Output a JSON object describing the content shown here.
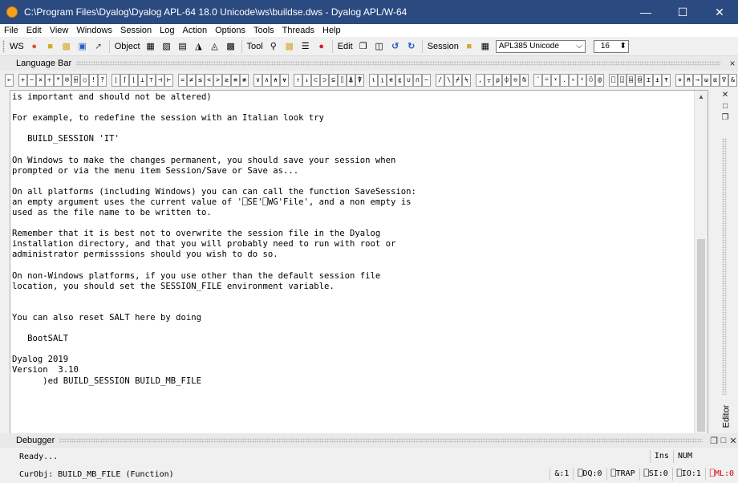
{
  "window": {
    "title": "C:\\Program Files\\Dyalog\\Dyalog APL-64 18.0 Unicode\\ws\\buildse.dws - Dyalog APL/W-64",
    "minimize": "—",
    "maximize": "☐",
    "close": "✕"
  },
  "menu": [
    "File",
    "Edit",
    "View",
    "Windows",
    "Session",
    "Log",
    "Action",
    "Options",
    "Tools",
    "Threads",
    "Help"
  ],
  "toolbar": {
    "ws_label": "WS",
    "object_label": "Object",
    "tool_label": "Tool",
    "edit_label": "Edit",
    "session_label": "Session",
    "font_value": "APL385 Unicode",
    "font_arrow": "⌵",
    "size_value": "16",
    "size_spinner": "⬍"
  },
  "language_bar": {
    "title": "Language Bar",
    "close": "×",
    "groups": [
      [
        "←"
      ],
      [
        "+",
        "−",
        "×",
        "÷",
        "*",
        "⍟",
        "⌹",
        "○",
        "!",
        "?"
      ],
      [
        "|",
        "⌈",
        "⌊",
        "⊥",
        "⊤",
        "⊣",
        "⊢"
      ],
      [
        "=",
        "≠",
        "≤",
        "<",
        ">",
        "≥",
        "≡",
        "≢"
      ],
      [
        "∨",
        "∧",
        "⍲",
        "⍱"
      ],
      [
        "↑",
        "↓",
        "⊂",
        "⊃",
        "⊆",
        "⌷",
        "⍋",
        "⍒"
      ],
      [
        "⍳",
        "⍸",
        "∊",
        "⍷",
        "∪",
        "∩",
        "~"
      ],
      [
        "/",
        "\\",
        "⌿",
        "⍀"
      ],
      [
        ",",
        "⍪",
        "⍴",
        "⌽",
        "⊖",
        "⍉"
      ],
      [
        "¨",
        "⍨",
        "⍣",
        ".",
        "∘",
        "⍤",
        "⍥",
        "@"
      ],
      [
        "⎕",
        "⍠",
        "⌸",
        "⌺",
        "⌶",
        "⍎",
        "⍕"
      ],
      [
        "⋄",
        "⍝",
        "→",
        "⍵",
        "⍺",
        "∇",
        "&"
      ],
      [
        "¯",
        "⍬"
      ]
    ]
  },
  "editor": {
    "lines": [
      "is important and should not be altered)",
      "",
      "For example, to redefine the session with an Italian look try",
      "",
      "   BUILD_SESSION 'IT'",
      "",
      "On Windows to make the changes permanent, you should save your session when",
      "prompted or via the menu item Session/Save or Save as...",
      "",
      "On all platforms (including Windows) you can can call the function SaveSession:",
      "an empty argument uses the current value of '⎕SE'⎕WG'File', and a non empty is",
      "used as the file name to be written to.",
      "",
      "Remember that it is best not to overwrite the session file in the Dyalog",
      "installation directory, and that you will probably need to run with root or",
      "administrator permisssions should you wish to do so.",
      "",
      "On non-Windows platforms, if you use other than the default session file",
      "location, you should set the SESSION_FILE environment variable.",
      "",
      "",
      "You can also reset SALT here by doing",
      "",
      "   BootSALT",
      "",
      "Dyalog 2019",
      "Version  3.10",
      "      )ed BUILD_SESSION BUILD_MB_FILE"
    ],
    "side_label": "Editor"
  },
  "debugger": {
    "title": "Debugger",
    "ready": "Ready...",
    "ins": "Ins",
    "num": "NUM"
  },
  "status": {
    "curobj": "CurObj: BUILD_MB_FILE (Function)",
    "amp": "&:1",
    "dq": "⎕DQ:0",
    "trap": "⎕TRAP",
    "si": "⎕SI:0",
    "io": "⎕IO:1",
    "ml": "⎕ML:0",
    "ml_color": "#d40000"
  }
}
